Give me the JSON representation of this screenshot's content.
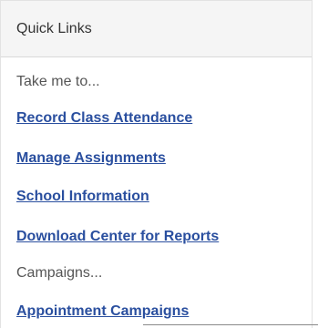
{
  "quick_links": {
    "title": "Quick Links",
    "take_me_to_label": "Take me to...",
    "links": [
      {
        "label": "Record Class Attendance"
      },
      {
        "label": "Manage Assignments"
      },
      {
        "label": "School Information"
      },
      {
        "label": "Download Center for Reports"
      }
    ],
    "campaigns_label": "Campaigns...",
    "campaign_links": [
      {
        "label": "Appointment Campaigns"
      }
    ]
  },
  "colors": {
    "link": "#2a4f9f",
    "header_bg": "#f5f5f5",
    "text_muted": "#555555"
  }
}
